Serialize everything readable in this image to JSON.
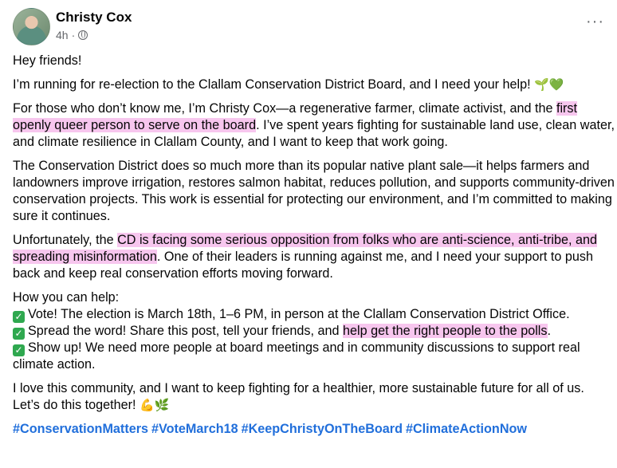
{
  "post": {
    "author": "Christy Cox",
    "time": "4h",
    "more_label": "···",
    "paragraphs": {
      "p1": "Hey friends!",
      "p2": "I’m running for re-election to the Clallam Conservation District Board, and I need your help!",
      "p3a": "For those who don’t know me, I’m Christy Cox—a regenerative farmer, climate activist, and the ",
      "p3hl": "first openly queer person to serve on the board",
      "p3b": ". I’ve spent years fighting for sustainable land use, clean water, and climate resilience in Clallam County, and I want to keep that work going.",
      "p4": "The Conservation District does so much more than its popular native plant sale—it helps farmers and landowners improve irrigation, restores salmon habitat, reduces pollution, and supports community-driven conservation projects. This work is essential for protecting our environment, and I’m committed to making sure it continues.",
      "p5a": "Unfortunately, the ",
      "p5hl": "CD is facing some serious opposition from folks who are anti-science, anti-tribe, and spreading misinformation",
      "p5b": ". One of their leaders is running against me, and I need your support to push back and keep real conservation efforts moving forward.",
      "p6_intro": "How you can help:",
      "p6_item1": "Vote! The election is March 18th, 1–6 PM, in person at the Clallam Conservation District Office.",
      "p6_item2a": "Spread the word! Share this post, tell your friends, and ",
      "p6_item2hl": "help get the right people to the polls",
      "p6_item2b": ".",
      "p6_item3": "Show up! We need more people at board meetings and in community discussions to support real climate action.",
      "p7a": "I love this community, and I want to keep fighting for a healthier, more sustainable future for all of us.",
      "p7b": "Let’s do this together!"
    },
    "hashtags": [
      "#ConservationMatters",
      "#VoteMarch18",
      "#KeepChristyOnTheBoard",
      "#ClimateActionNow"
    ],
    "icons": {
      "privacy": "globe-icon",
      "more": "more-options-icon",
      "seedling": "seedling-emoji",
      "heart": "green-heart-emoji",
      "check": "check-mark-emoji",
      "muscle": "flexed-biceps-emoji",
      "herb": "herb-emoji"
    },
    "colors": {
      "highlight": "#f7c6ee",
      "hashtag": "#216fdb",
      "check": "#2fa84f"
    }
  }
}
